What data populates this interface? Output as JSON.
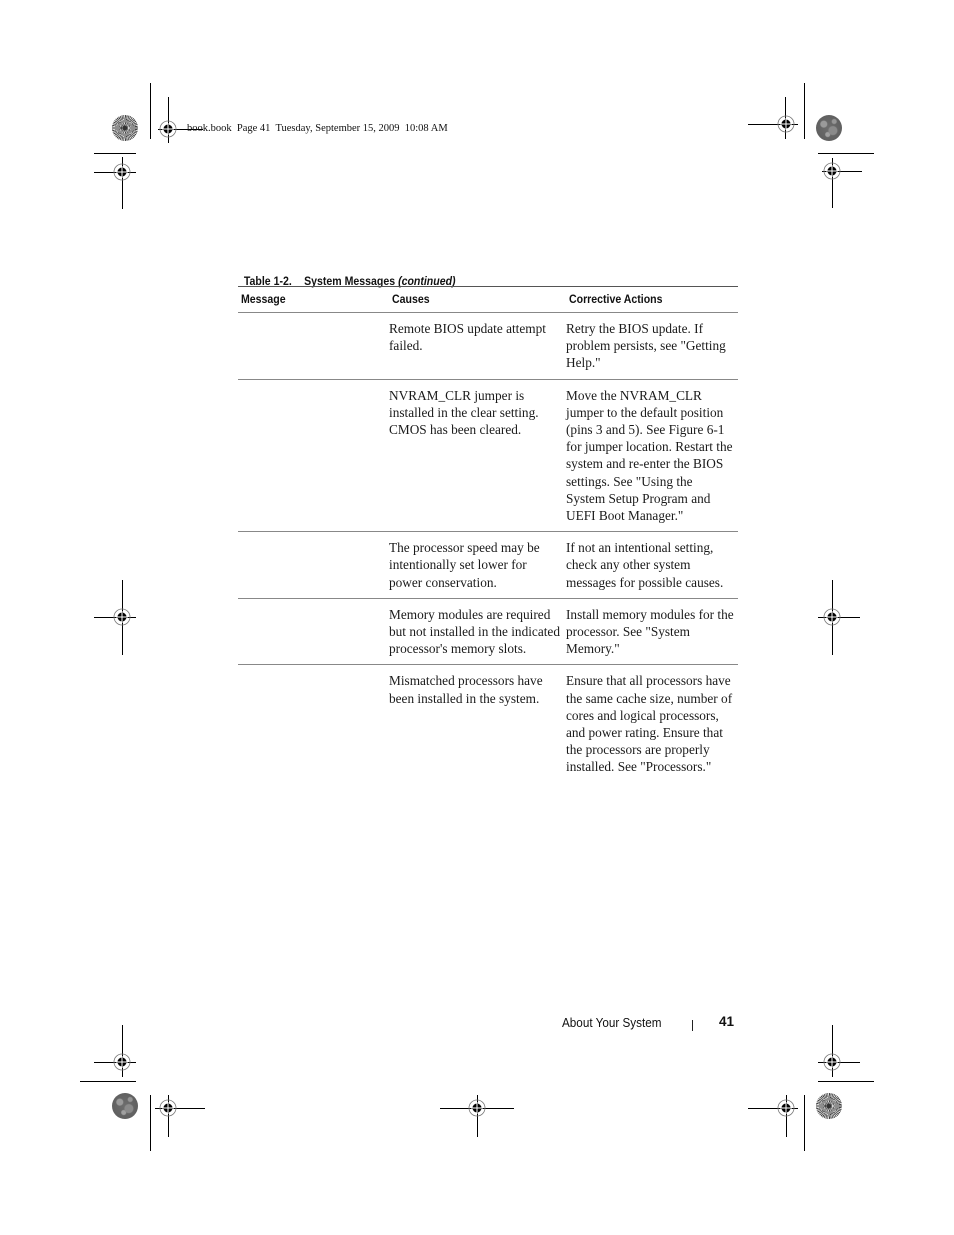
{
  "print_slug": "book.book  Page 41  Tuesday, September 15, 2009  10:08 AM",
  "table": {
    "caption_number": "Table 1-2.",
    "caption_title": "System Messages",
    "caption_continued": "(continued)",
    "headers": [
      "Message",
      "Causes",
      "Corrective Actions"
    ],
    "rows": [
      {
        "message": "",
        "causes": "Remote BIOS update attempt failed.",
        "actions": "Retry the BIOS update. If problem persists, see \"Getting Help.\""
      },
      {
        "message": "",
        "causes": "NVRAM_CLR jumper is installed in the clear setting. CMOS has been cleared.",
        "actions": "Move the NVRAM_CLR jumper to the default position (pins 3 and 5). See Figure 6-1 for jumper location. Restart the system and re-enter the BIOS settings. See \"Using the System Setup Program and UEFI Boot Manager.\""
      },
      {
        "message": "",
        "causes": "The processor speed may be intentionally set lower for power conservation.",
        "actions": "If not an intentional setting, check any other system messages for possible causes."
      },
      {
        "message": "",
        "causes": "Memory modules are required but not installed in the indicated processor's memory slots.",
        "actions": "Install memory modules for the processor. See \"System Memory.\""
      },
      {
        "message": "",
        "causes": "Mismatched processors have been installed in the system.",
        "actions": "Ensure that all processors have the same cache size, number of cores and logical processors, and power rating. Ensure that the processors are properly installed. See \"Processors.\""
      }
    ]
  },
  "footer": {
    "section_title": "About Your System",
    "page_number": "41"
  },
  "marks": {
    "registration_icon": "registration-mark-icon",
    "starburst_icon": "starburst-color-bar-icon",
    "mottled_icon": "mottled-color-bar-icon"
  }
}
